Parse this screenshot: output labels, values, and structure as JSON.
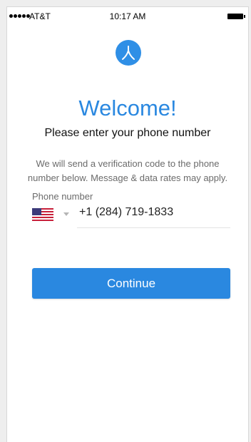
{
  "status_bar": {
    "carrier": "AT&T",
    "time": "10:17 AM"
  },
  "logo": {
    "icon": "app-logo-icon",
    "color": "#2f8fe6"
  },
  "header": {
    "title": "Welcome!",
    "subtitle": "Please enter your phone number"
  },
  "description": {
    "line1": "We will send a verification code to the phone",
    "line2": "number below.  Message & data rates may apply."
  },
  "phone": {
    "label": "Phone number",
    "country_icon": "us-flag-icon",
    "value": "+1 (284) 719-1833"
  },
  "actions": {
    "continue_label": "Continue"
  },
  "colors": {
    "accent": "#2a88e0"
  }
}
